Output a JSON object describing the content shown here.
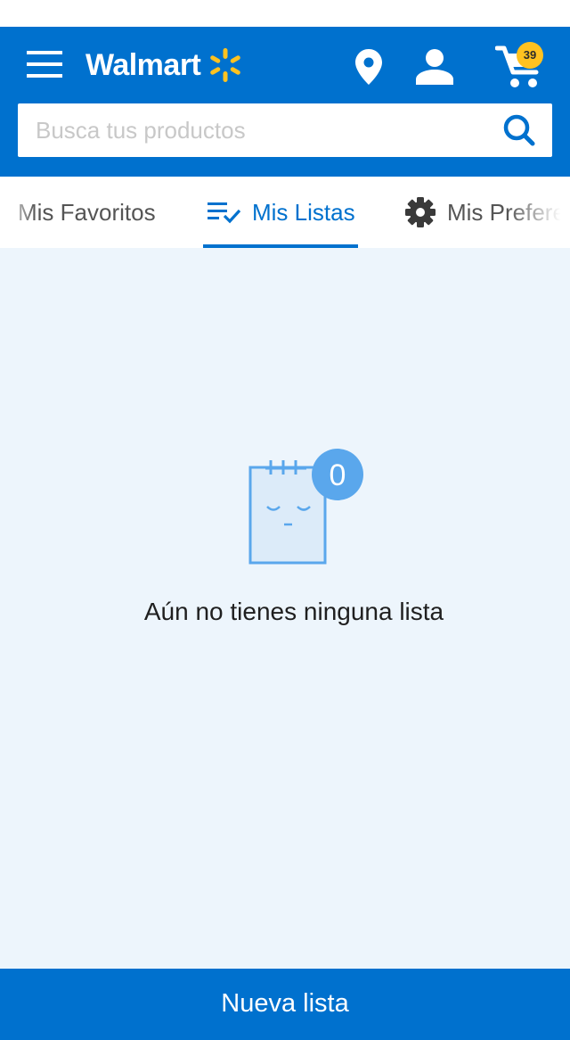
{
  "header": {
    "brand": "Walmart",
    "cart_count": "39",
    "icons": [
      "menu-icon",
      "walmart-spark-icon",
      "location-pin-icon",
      "account-icon",
      "cart-icon",
      "search-icon"
    ],
    "colors": {
      "brand_blue": "#0071ce",
      "spark_yellow": "#ffc220"
    }
  },
  "search": {
    "placeholder": "Busca tus productos"
  },
  "tabs": [
    {
      "label": "Mis Favoritos"
    },
    {
      "label": "Mis Listas",
      "selected": true,
      "icon": "list-check-icon"
    },
    {
      "label": "Mis Preferencias",
      "icon": "gear-icon"
    }
  ],
  "empty_state": {
    "badge_count": "0",
    "message": "Aún no tienes ninguna lista",
    "icon": "notepad-sleepy-icon"
  },
  "footer": {
    "new_list_label": "Nueva lista"
  }
}
